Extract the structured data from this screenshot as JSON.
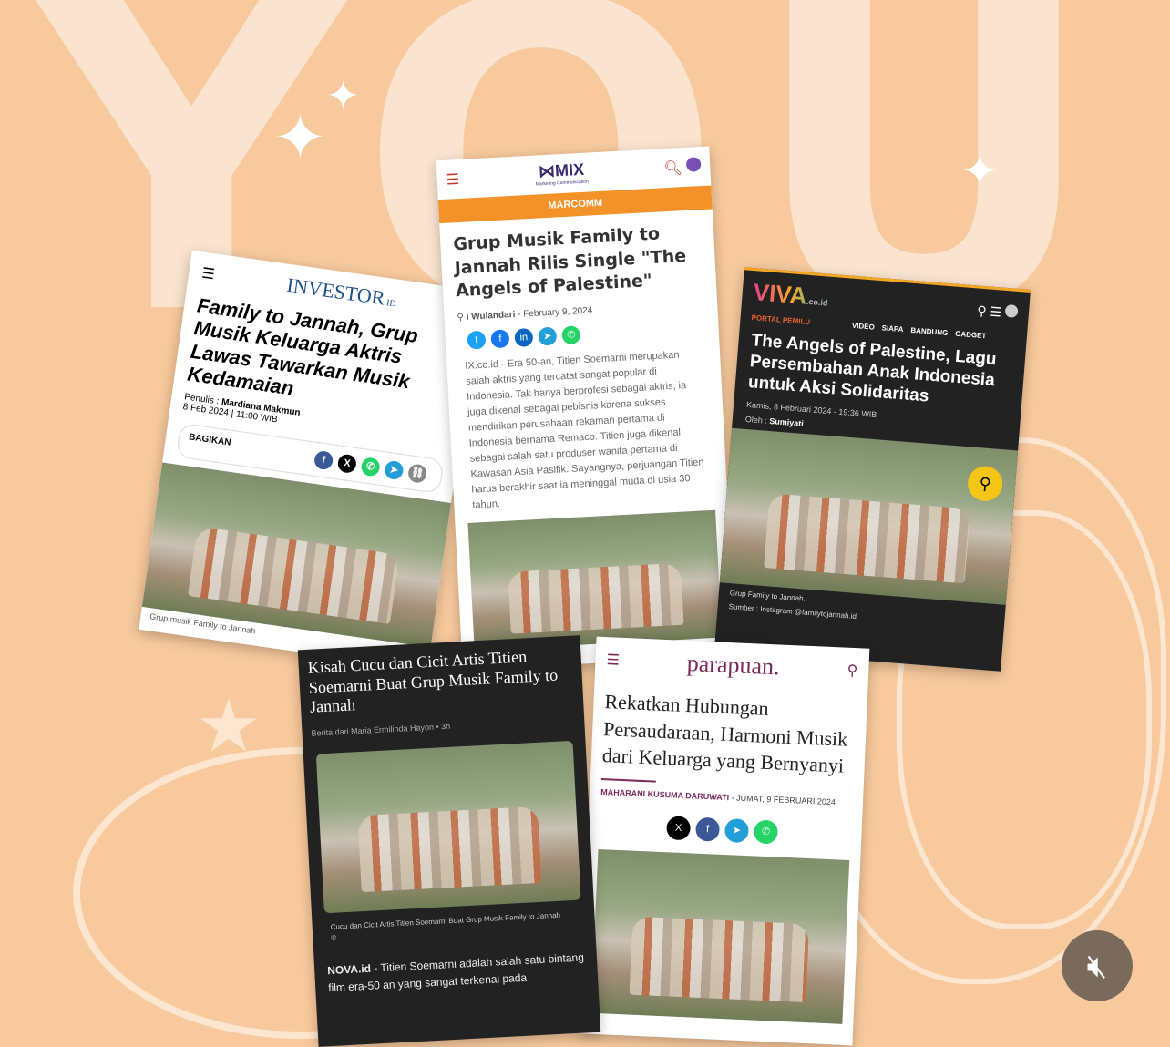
{
  "background": {
    "word": "YOU"
  },
  "investor": {
    "logo": "INVESTOR",
    "logo_suffix": ".ID",
    "title": "Family to Jannah, Grup Musik Keluarga Aktris Lawas Tawarkan Musik Kedamaian",
    "author_label": "Penulis :",
    "author": "Mardiana Makmun",
    "date": "8 Feb 2024 | 11:00 WIB",
    "share_label": "BAGIKAN",
    "caption": "Grup musik Family to Jannah"
  },
  "mix": {
    "logo": "MIX",
    "logo_sub": "Marketing Communication",
    "category": "MARCOMM",
    "title": "Grup Musik Family to Jannah Rilis Single \"The Angels of Palestine\"",
    "author": "i Wulandari",
    "date": "- February 9, 2024",
    "body": "IX.co.id - Era 50-an, Titien Soemarni merupakan salah aktris yang tercatat sangat popular di Indonesia. Tak hanya berprofesi sebagai aktris, ia juga dikenal sebagai pebisnis karena sukses mendirikan perusahaan rekaman pertama di Indonesia bernama Remaco. Titien juga dikenal sebagai salah satu produser wanita pertama di Kawasan Asia Pasifik. Sayangnya, perjuangan Titien harus berakhir saat ia meninggal muda di usia 30 tahun."
  },
  "viva": {
    "logo": "VIVA",
    "logo_suffix": ".co.id",
    "portal": "PORTAL PEMILU",
    "nav": [
      "VIDEO",
      "SIAPA",
      "BANDUNG",
      "GADGET"
    ],
    "title": "The Angels of Palestine, Lagu Persembahan Anak Indonesia untuk Aksi Solidaritas",
    "date": "Kamis, 8 Februari 2024 - 19:36 WIB",
    "author_label": "Oleh :",
    "author": "Sumiyati",
    "caption": "Grup Family to Jannah.",
    "source": "Sumber : Instagram @familytojannah.id"
  },
  "nova": {
    "title": "Kisah Cucu dan Cicit Artis Titien Soemarni Buat Grup Musik Family to Jannah",
    "byline": "Berita dari Maria Ermilinda Hayon",
    "time": "3h",
    "caption": "Cucu dan Cicit Artis Titien Soemarni Buat Grup Musik Family to Jannah",
    "copyright": "©",
    "source": "NOVA.id",
    "body": " - Titien Soemarni adalah salah satu bintang film era-50 an yang sangat terkenal pada"
  },
  "parapuan": {
    "logo": "parapuan.",
    "title": "Rekatkan Hubungan Persaudaraan, Harmoni Musik dari Keluarga yang Bernyanyi",
    "author": "MAHARANI KUSUMA DARUWATI",
    "date": "- JUMAT, 9 FEBRUARI 2024"
  },
  "controls": {
    "mute": "muted"
  }
}
